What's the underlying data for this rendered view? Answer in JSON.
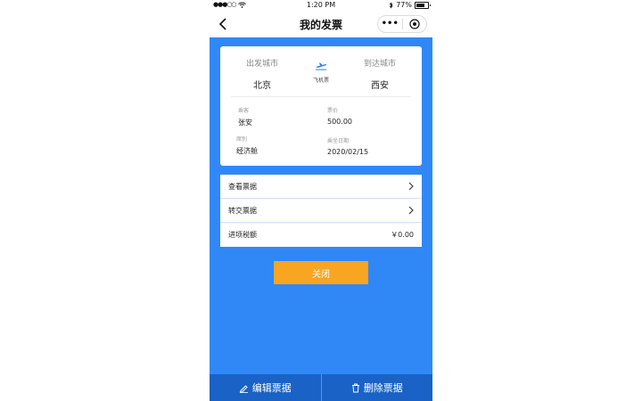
{
  "status_bar": {
    "signal": "●●●○○",
    "time": "1:20 PM",
    "battery_pct": "77%"
  },
  "nav": {
    "title": "我的发票",
    "more_label": "•••"
  },
  "ticket": {
    "depart_label": "出发城市",
    "depart_city": "北京",
    "arrive_label": "到达城市",
    "arrive_city": "西安",
    "type_label": "飞机票",
    "passenger_label": "乘客",
    "passenger": "张安",
    "price_label": "票价",
    "price": "500.00",
    "class_label": "席别",
    "class": "经济舱",
    "date_label": "乘坐日期",
    "date": "2020/02/15"
  },
  "menu": {
    "items": [
      {
        "label": "查看票据"
      },
      {
        "label": "转交票据"
      },
      {
        "label": "进项税额",
        "value": "￥0.00"
      }
    ]
  },
  "actions": {
    "close_label": "关闭",
    "edit_label": "编辑票据",
    "delete_label": "删除票据"
  },
  "colors": {
    "background": "#3088f7",
    "close_button": "#f8a521",
    "bottom_bar": "#1a62c6"
  }
}
